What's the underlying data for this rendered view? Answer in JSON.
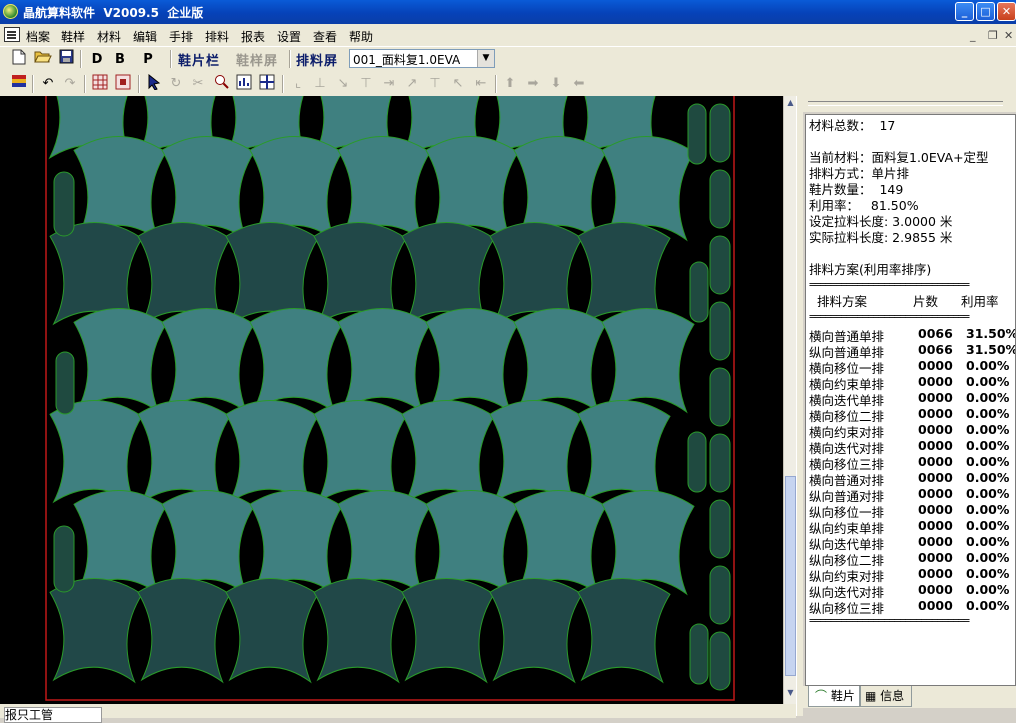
{
  "window": {
    "title": "晶航算料软件  V2009.5  企业版",
    "buttons": {
      "minimize": "_",
      "maximize": "□",
      "close": "✕"
    }
  },
  "menu": {
    "items": [
      "档案",
      "鞋样",
      "材料",
      "编辑",
      "手排",
      "排料",
      "报表",
      "设置",
      "查看",
      "帮助"
    ],
    "mdi": {
      "minimize": "_",
      "restore": "❐",
      "close": "✕"
    }
  },
  "toolbar": {
    "letter_buttons": [
      "D",
      "B",
      "P"
    ],
    "tabs": [
      {
        "label": "鞋片栏",
        "state": "active"
      },
      {
        "label": "鞋样屏",
        "state": "disabled"
      },
      {
        "label": "排料屏",
        "state": "active"
      }
    ],
    "material_select": "001_面料复1.0EVA"
  },
  "colors": {
    "piece_light": "#3f8080",
    "piece_dark": "#214848",
    "outline": "#2a9a2a",
    "canvas": "#000000",
    "border_red": "#c01818"
  },
  "info": {
    "total_label": "材料总数：  17",
    "lines": [
      "当前材料：面料复1.0EVA+定型",
      "排料方式：单片排",
      "鞋片数量：  149",
      "利用率：   81.50%",
      "设定拉料长度: 3.0000 米",
      "实际拉料长度: 2.9855 米"
    ],
    "plan_title": "排料方案(利用率排序)",
    "rule": "==============================",
    "header": {
      "name": "排料方案",
      "count": "片数",
      "rate": "利用率"
    },
    "rows": [
      {
        "name": "横向普通单排",
        "count": "0066",
        "rate": "31.50%"
      },
      {
        "name": "纵向普通单排",
        "count": "0066",
        "rate": "31.50%"
      },
      {
        "name": "横向移位一排",
        "count": "0000",
        "rate": "0.00%"
      },
      {
        "name": "横向约束单排",
        "count": "0000",
        "rate": "0.00%"
      },
      {
        "name": "横向迭代单排",
        "count": "0000",
        "rate": "0.00%"
      },
      {
        "name": "横向移位二排",
        "count": "0000",
        "rate": "0.00%"
      },
      {
        "name": "横向约束对排",
        "count": "0000",
        "rate": "0.00%"
      },
      {
        "name": "横向迭代对排",
        "count": "0000",
        "rate": "0.00%"
      },
      {
        "name": "横向移位三排",
        "count": "0000",
        "rate": "0.00%"
      },
      {
        "name": "横向普通对排",
        "count": "0000",
        "rate": "0.00%"
      },
      {
        "name": "纵向普通对排",
        "count": "0000",
        "rate": "0.00%"
      },
      {
        "name": "纵向移位一排",
        "count": "0000",
        "rate": "0.00%"
      },
      {
        "name": "纵向约束单排",
        "count": "0000",
        "rate": "0.00%"
      },
      {
        "name": "纵向迭代单排",
        "count": "0000",
        "rate": "0.00%"
      },
      {
        "name": "纵向移位二排",
        "count": "0000",
        "rate": "0.00%"
      },
      {
        "name": "纵向约束对排",
        "count": "0000",
        "rate": "0.00%"
      },
      {
        "name": "纵向迭代对排",
        "count": "0000",
        "rate": "0.00%"
      },
      {
        "name": "纵向移位三排",
        "count": "0000",
        "rate": "0.00%"
      }
    ]
  },
  "panel_tabs": [
    "鞋片",
    "信息"
  ],
  "status": {
    "tab": "报只工管"
  }
}
